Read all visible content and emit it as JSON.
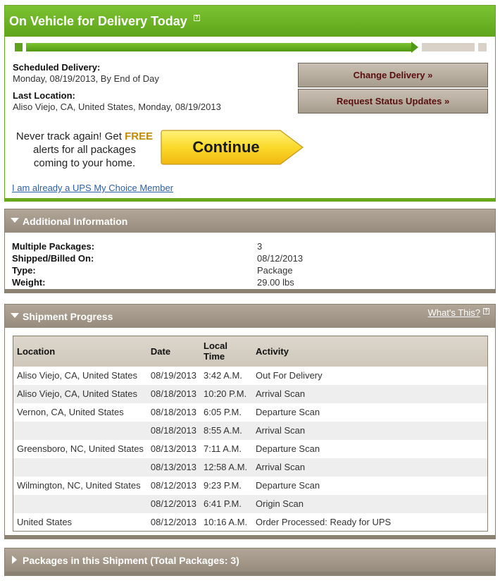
{
  "status": {
    "title": "On Vehicle for Delivery Today",
    "help_glyph": "?",
    "scheduled_label": "Scheduled Delivery:",
    "scheduled_value": "Monday, 08/19/2013, By End of Day",
    "last_location_label": "Last Location:",
    "last_location_value": "Aliso Viejo, CA, United States, Monday, 08/19/2013",
    "change_delivery_label": "Change Delivery »",
    "request_updates_label": "Request Status Updates »",
    "promo_line1_prefix": "Never track again! Get ",
    "promo_free": "FREE",
    "promo_line2": "alerts for all packages",
    "promo_line3": "coming to your home.",
    "continue_label": "Continue",
    "member_link": "I am already a UPS My Choice Member",
    "colors": {
      "accent_green": "#6aa81e",
      "button_text": "#5a0f0f",
      "promo_yellow": "#f7d21c"
    }
  },
  "additional_info": {
    "title": "Additional Information",
    "rows": [
      {
        "label": "Multiple Packages:",
        "value": "3"
      },
      {
        "label": "Shipped/Billed On:",
        "value": "08/12/2013"
      },
      {
        "label": "Type:",
        "value": "Package"
      },
      {
        "label": "Weight:",
        "value": "29.00 lbs"
      }
    ]
  },
  "shipment_progress": {
    "title": "Shipment Progress",
    "whats_this": "What's This?",
    "columns": {
      "location": "Location",
      "date": "Date",
      "local_time_1": "Local",
      "local_time_2": "Time",
      "activity": "Activity"
    },
    "rows": [
      {
        "location": "Aliso Viejo, CA, United States",
        "date": "08/19/2013",
        "time": "3:42 A.M.",
        "activity": "Out For Delivery"
      },
      {
        "location": "Aliso Viejo, CA, United States",
        "date": "08/18/2013",
        "time": "10:20 P.M.",
        "activity": "Arrival Scan"
      },
      {
        "location": "Vernon, CA, United States",
        "date": "08/18/2013",
        "time": "6:05 P.M.",
        "activity": "Departure Scan"
      },
      {
        "location": "",
        "date": "08/18/2013",
        "time": "8:55 A.M.",
        "activity": "Arrival Scan"
      },
      {
        "location": "Greensboro, NC, United States",
        "date": "08/13/2013",
        "time": "7:11 A.M.",
        "activity": "Departure Scan"
      },
      {
        "location": "",
        "date": "08/13/2013",
        "time": "12:58 A.M.",
        "activity": "Arrival Scan"
      },
      {
        "location": "Wilmington, NC, United States",
        "date": "08/12/2013",
        "time": "9:23 P.M.",
        "activity": "Departure Scan"
      },
      {
        "location": "",
        "date": "08/12/2013",
        "time": "6:41 P.M.",
        "activity": "Origin Scan"
      },
      {
        "location": "United States",
        "date": "08/12/2013",
        "time": "10:16 A.M.",
        "activity": "Order Processed: Ready for UPS"
      }
    ]
  },
  "packages": {
    "title": "Packages in this Shipment (Total Packages: 3)"
  }
}
